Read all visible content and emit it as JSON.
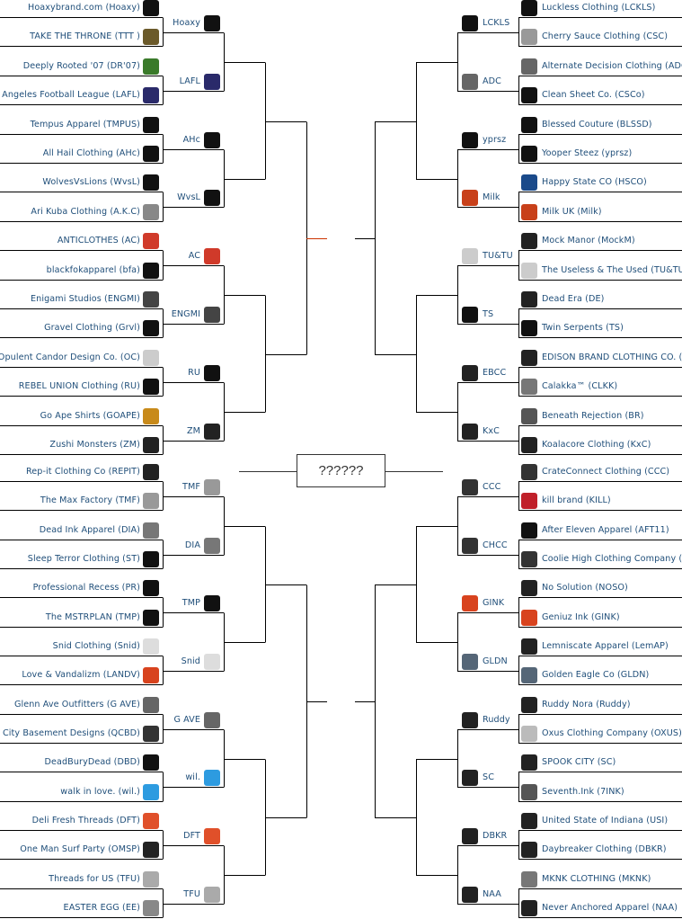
{
  "colors": {
    "text": "#1f4e79",
    "line": "#000000",
    "highlight_line": "#cc3300"
  },
  "final": {
    "label": "??????"
  },
  "left": {
    "round1": [
      {
        "name": "Hoaxybrand.com (Hoaxy)",
        "icon_color": "#111111"
      },
      {
        "name": "TAKE THE THRONE (TTT )",
        "icon_color": "#6b5a2a"
      },
      {
        "name": "Deeply Rooted '07 (DR'07)",
        "icon_color": "#3a7a2a"
      },
      {
        "name": "Los Angeles Football League (LAFL)",
        "icon_color": "#2a2a6a"
      },
      {
        "name": "Tempus Apparel (TMPUS)",
        "icon_color": "#111111"
      },
      {
        "name": "All Hail Clothing (AHc)",
        "icon_color": "#111111"
      },
      {
        "name": "WolvesVsLions (WvsL)",
        "icon_color": "#111111"
      },
      {
        "name": "Ari Kuba Clothing (A.K.C)",
        "icon_color": "#888888"
      },
      {
        "name": "ANTICLOTHES (AC)",
        "icon_color": "#d03a2a"
      },
      {
        "name": "blackfokapparel (bfa)",
        "icon_color": "#111111"
      },
      {
        "name": "Enigami Studios (ENGMI)",
        "icon_color": "#444444"
      },
      {
        "name": "Gravel Clothing (Grvl)",
        "icon_color": "#111111"
      },
      {
        "name": "Opulent Candor Design Co. (OC)",
        "icon_color": "#cccccc"
      },
      {
        "name": "REBEL UNION Clothing (RU)",
        "icon_color": "#111111"
      },
      {
        "name": "Go Ape Shirts (GOAPE)",
        "icon_color": "#c88a1a"
      },
      {
        "name": "Zushi Monsters (ZM)",
        "icon_color": "#222222"
      },
      {
        "name": "Rep-it Clothing Co (REPIT)",
        "icon_color": "#222222"
      },
      {
        "name": "The Max Factory (TMF)",
        "icon_color": "#999999"
      },
      {
        "name": "Dead Ink Apparel (DIA)",
        "icon_color": "#777777"
      },
      {
        "name": "Sleep Terror Clothing (ST)",
        "icon_color": "#111111"
      },
      {
        "name": "Professional Recess (PR)",
        "icon_color": "#111111"
      },
      {
        "name": "The MSTRPLAN (TMP)",
        "icon_color": "#111111"
      },
      {
        "name": "Snid Clothing (Snid)",
        "icon_color": "#dddddd"
      },
      {
        "name": "Love & Vandalizm (LANDV)",
        "icon_color": "#d8431e"
      },
      {
        "name": "Glenn Ave Outfitters (G AVE)",
        "icon_color": "#666666"
      },
      {
        "name": "Queen City Basement Designs (QCBD)",
        "icon_color": "#333333"
      },
      {
        "name": "DeadBuryDead (DBD)",
        "icon_color": "#111111"
      },
      {
        "name": "walk in love. (wil.)",
        "icon_color": "#2d9be0"
      },
      {
        "name": "Deli Fresh Threads (DFT)",
        "icon_color": "#e0502a"
      },
      {
        "name": "One Man Surf Party (OMSP)",
        "icon_color": "#222222"
      },
      {
        "name": "Threads for US (TFU)",
        "icon_color": "#aaaaaa"
      },
      {
        "name": "EASTER EGG (EE)",
        "icon_color": "#888888"
      }
    ],
    "round2": [
      {
        "abbr": "Hoaxy",
        "icon_color": "#111111"
      },
      {
        "abbr": "LAFL",
        "icon_color": "#2a2a6a"
      },
      {
        "abbr": "AHc",
        "icon_color": "#111111"
      },
      {
        "abbr": "WvsL",
        "icon_color": "#111111"
      },
      {
        "abbr": "AC",
        "icon_color": "#d03a2a"
      },
      {
        "abbr": "ENGMI",
        "icon_color": "#444444"
      },
      {
        "abbr": "RU",
        "icon_color": "#111111"
      },
      {
        "abbr": "ZM",
        "icon_color": "#222222"
      },
      {
        "abbr": "TMF",
        "icon_color": "#999999"
      },
      {
        "abbr": "DIA",
        "icon_color": "#777777"
      },
      {
        "abbr": "TMP",
        "icon_color": "#111111"
      },
      {
        "abbr": "Snid",
        "icon_color": "#dddddd"
      },
      {
        "abbr": "G AVE",
        "icon_color": "#666666"
      },
      {
        "abbr": "wil.",
        "icon_color": "#2d9be0"
      },
      {
        "abbr": "DFT",
        "icon_color": "#e0502a"
      },
      {
        "abbr": "TFU",
        "icon_color": "#aaaaaa"
      }
    ]
  },
  "right": {
    "round1": [
      {
        "name": "Luckless Clothing (LCKLS)",
        "icon_color": "#111111"
      },
      {
        "name": "Cherry Sauce Clothing (CSC)",
        "icon_color": "#999999"
      },
      {
        "name": "Alternate Decision Clothing (ADC)",
        "icon_color": "#666666"
      },
      {
        "name": "Clean Sheet Co. (CSCo)",
        "icon_color": "#111111"
      },
      {
        "name": "Blessed Couture (BLSSD)",
        "icon_color": "#111111"
      },
      {
        "name": "Yooper Steez (yprsz)",
        "icon_color": "#111111"
      },
      {
        "name": "Happy State CO (HSCO)",
        "icon_color": "#1a4a8a"
      },
      {
        "name": "Milk UK (Milk)",
        "icon_color": "#c8401a"
      },
      {
        "name": "Mock Manor (MockM)",
        "icon_color": "#222222"
      },
      {
        "name": "The Useless & The Used (TU&TU)",
        "icon_color": "#cccccc"
      },
      {
        "name": "Dead Era (DE)",
        "icon_color": "#222222"
      },
      {
        "name": "Twin Serpents (TS)",
        "icon_color": "#111111"
      },
      {
        "name": "EDISON BRAND CLOTHING CO. (EBCC)",
        "icon_color": "#222222"
      },
      {
        "name": "Calakka™ (CLKK)",
        "icon_color": "#777777"
      },
      {
        "name": "Beneath Rejection (BR)",
        "icon_color": "#555555"
      },
      {
        "name": "Koalacore Clothing (KxC)",
        "icon_color": "#222222"
      },
      {
        "name": "CrateConnect Clothing (CCC)",
        "icon_color": "#333333"
      },
      {
        "name": "kill brand (KILL)",
        "icon_color": "#c0202a"
      },
      {
        "name": "After Eleven Apparel (AFT11)",
        "icon_color": "#111111"
      },
      {
        "name": "Coolie High Clothing Company (CHCC)",
        "icon_color": "#333333"
      },
      {
        "name": "No Solution (NOSO)",
        "icon_color": "#222222"
      },
      {
        "name": "Geniuz Ink (GINK)",
        "icon_color": "#d8431e"
      },
      {
        "name": "Lemniscate Apparel (LemAP)",
        "icon_color": "#222222"
      },
      {
        "name": "Golden Eagle Co (GLDN)",
        "icon_color": "#556677"
      },
      {
        "name": "Ruddy Nora (Ruddy)",
        "icon_color": "#222222"
      },
      {
        "name": "Oxus Clothing Company (OXUS)",
        "icon_color": "#bbbbbb"
      },
      {
        "name": "SPOOK CITY (SC)",
        "icon_color": "#222222"
      },
      {
        "name": "Seventh.Ink (7INK)",
        "icon_color": "#555555"
      },
      {
        "name": "United State of Indiana (USI)",
        "icon_color": "#222222"
      },
      {
        "name": "Daybreaker Clothing (DBKR)",
        "icon_color": "#222222"
      },
      {
        "name": "MKNK CLOTHING (MKNK)",
        "icon_color": "#777777"
      },
      {
        "name": "Never Anchored Apparel (NAA)",
        "icon_color": "#222222"
      }
    ],
    "round2": [
      {
        "abbr": "LCKLS",
        "icon_color": "#111111"
      },
      {
        "abbr": "ADC",
        "icon_color": "#666666"
      },
      {
        "abbr": "yprsz",
        "icon_color": "#111111"
      },
      {
        "abbr": "Milk",
        "icon_color": "#c8401a"
      },
      {
        "abbr": "TU&TU",
        "icon_color": "#cccccc"
      },
      {
        "abbr": "TS",
        "icon_color": "#111111"
      },
      {
        "abbr": "EBCC",
        "icon_color": "#222222"
      },
      {
        "abbr": "KxC",
        "icon_color": "#222222"
      },
      {
        "abbr": "CCC",
        "icon_color": "#333333"
      },
      {
        "abbr": "CHCC",
        "icon_color": "#333333"
      },
      {
        "abbr": "GINK",
        "icon_color": "#d8431e"
      },
      {
        "abbr": "GLDN",
        "icon_color": "#556677"
      },
      {
        "abbr": "Ruddy",
        "icon_color": "#222222"
      },
      {
        "abbr": "SC",
        "icon_color": "#222222"
      },
      {
        "abbr": "DBKR",
        "icon_color": "#222222"
      },
      {
        "abbr": "NAA",
        "icon_color": "#222222"
      }
    ]
  }
}
